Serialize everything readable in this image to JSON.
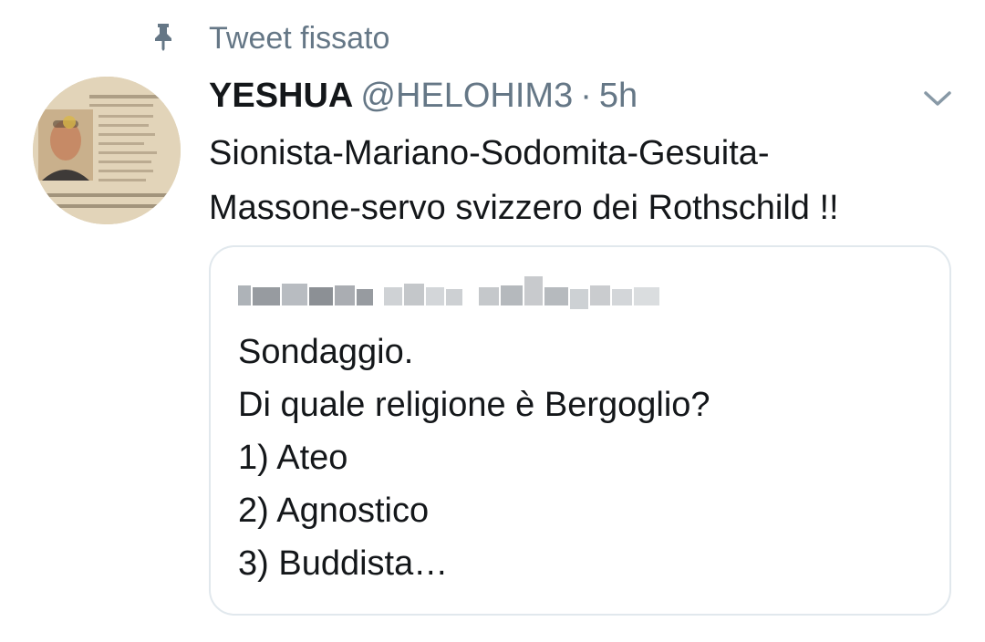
{
  "pinned": {
    "label": "Tweet fissato",
    "icon": "pin-icon"
  },
  "tweet": {
    "display_name": "YESHUA",
    "handle": "@HELOHIM3",
    "separator": "·",
    "time": "5h",
    "text_lines": [
      "Sionista-Mariano-Sodomita-Gesuita-",
      "Massone-servo svizzero dei Rothschild !!"
    ],
    "avatar_icon": "avatar",
    "menu_icon": "chevron-down-icon"
  },
  "quote": {
    "author_blurred": true,
    "lines": [
      "Sondaggio.",
      "Di quale religione è Bergoglio?",
      "1) Ateo",
      "2) Agnostico",
      "3) Buddista…"
    ]
  },
  "colors": {
    "text": "#14171a",
    "secondary": "#657786",
    "border": "#e1e8ed",
    "background": "#ffffff"
  }
}
